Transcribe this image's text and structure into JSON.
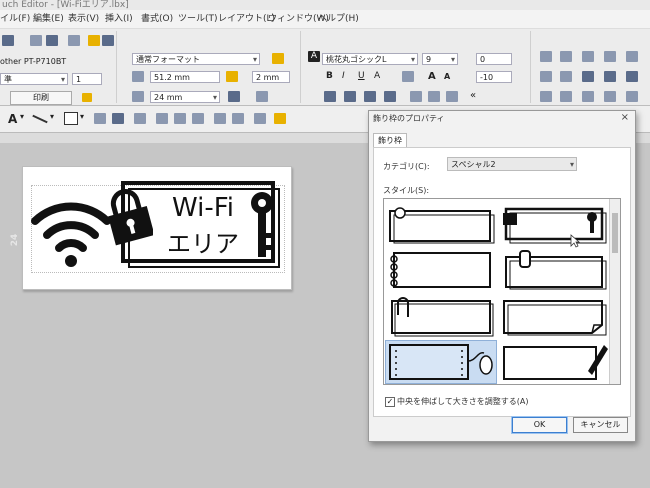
{
  "app": {
    "title": "uch Editor - [Wi-Fiエリア.lbx]"
  },
  "menu": [
    "イル(F)",
    "編集(E)",
    "表示(V)",
    "挿入(I)",
    "書式(O)",
    "ツール(T)",
    "レイアウト(L)",
    "ウィンドウ(W)",
    "ヘルプ(H)"
  ],
  "printer": {
    "name": "other PT-P710BT",
    "quality": "準",
    "copies": "1",
    "print_label": "印刷"
  },
  "format": {
    "preset": "通常フォーマット",
    "width": "51.2 mm",
    "margin": "2 mm",
    "height": "24 mm"
  },
  "font": {
    "family": "桃花丸ゴシックL",
    "size": "9",
    "spacing": "0",
    "line_spacing": "-10"
  },
  "canvas": {
    "tape_height": "24 mm",
    "label_text_line1": "Wi-Fi",
    "label_text_line2": "エリア"
  },
  "dialog": {
    "title": "飾り枠のプロパティ",
    "close": "×",
    "tab": "飾り枠",
    "category_label": "カテゴリ(C):",
    "category_value": "スペシャル2",
    "style_label": "スタイル(S):",
    "checkbox_checked": true,
    "checkbox_label": "中央を伸ばして大きさを調整する(A)",
    "ok": "OK",
    "cancel": "キャンセル"
  },
  "colors": {
    "accent": "#3c7fd0",
    "selection": "#c9dcf2"
  }
}
